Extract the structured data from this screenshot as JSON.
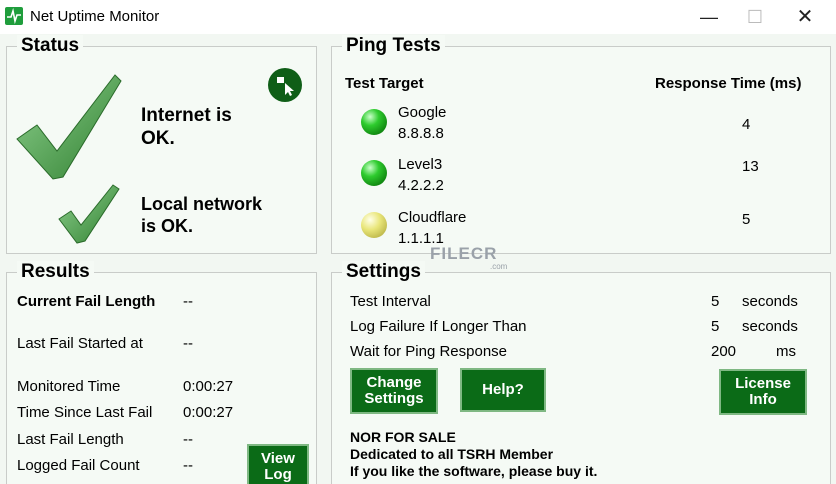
{
  "window": {
    "title": "Net Uptime Monitor",
    "minimize_glyph": "—",
    "maximize_glyph": "☐",
    "close_glyph": "✕"
  },
  "status": {
    "title": "Status",
    "internet_line1": "Internet is",
    "internet_line2": "OK.",
    "local_line1": "Local network",
    "local_line2": "is OK."
  },
  "ping": {
    "title": "Ping Tests",
    "col_target": "Test Target",
    "col_response": "Response Time (ms)",
    "targets": [
      {
        "name": "Google",
        "ip": "8.8.8.8",
        "ms": "4",
        "status": "green"
      },
      {
        "name": "Level3",
        "ip": "4.2.2.2",
        "ms": "13",
        "status": "green"
      },
      {
        "name": "Cloudflare",
        "ip": "1.1.1.1",
        "ms": "5",
        "status": "yellow"
      }
    ]
  },
  "results": {
    "title": "Results",
    "rows": [
      {
        "label": "Current Fail Length",
        "value": "--"
      },
      {
        "label": "Last Fail Started at",
        "value": "--"
      },
      {
        "label": "Monitored Time",
        "value": "0:00:27"
      },
      {
        "label": "Time Since Last Fail",
        "value": "0:00:27"
      },
      {
        "label": "Last Fail Length",
        "value": "--"
      },
      {
        "label": "Logged Fail Count",
        "value": "--"
      }
    ],
    "view_log_line1": "View",
    "view_log_line2": "Log"
  },
  "settings": {
    "title": "Settings",
    "rows": [
      {
        "label": "Test Interval",
        "value": "5",
        "unit": "seconds"
      },
      {
        "label": "Log Failure If Longer Than",
        "value": "5",
        "unit": "seconds"
      },
      {
        "label": "Wait for Ping Response",
        "value": "200",
        "unit": "ms"
      }
    ],
    "change_line1": "Change",
    "change_line2": "Settings",
    "help": "Help?",
    "license_line1": "License",
    "license_line2": "Info",
    "notice_line1": "NOR FOR SALE",
    "notice_line2": "Dedicated to all TSRH Member",
    "notice_line3": "If you like the software, please buy it."
  },
  "watermark": {
    "text": "FILECR",
    "sub": ".com"
  },
  "colors": {
    "button_green": "#0b6b17",
    "check_green": "#3c9a3c",
    "led_green": "#2ecc2e",
    "led_yellow": "#e9e67a"
  }
}
